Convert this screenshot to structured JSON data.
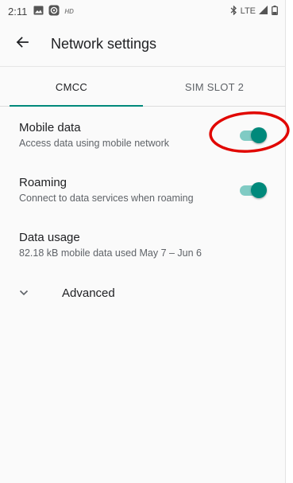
{
  "status_bar": {
    "time": "2:11",
    "indicators": [
      "image-icon",
      "app-icon",
      "hd-icon"
    ],
    "hd_label": "HD",
    "network": "LTE"
  },
  "app_bar": {
    "title": "Network settings",
    "back_icon": "arrow-back-icon"
  },
  "tabs": [
    {
      "label": "CMCC",
      "selected": true
    },
    {
      "label": "SIM SLOT 2",
      "selected": false
    }
  ],
  "settings": {
    "mobile_data": {
      "title": "Mobile data",
      "summary": "Access data using mobile network",
      "enabled": true
    },
    "roaming": {
      "title": "Roaming",
      "summary": "Connect to data services when roaming",
      "enabled": true
    },
    "data_usage": {
      "title": "Data usage",
      "summary": "82.18 kB mobile data used May 7 – Jun 6"
    },
    "advanced": {
      "label": "Advanced",
      "icon": "chevron-down-icon"
    }
  },
  "colors": {
    "accent": "#00897b",
    "accent_track": "#80cbc4",
    "annotation": "#e10600"
  }
}
